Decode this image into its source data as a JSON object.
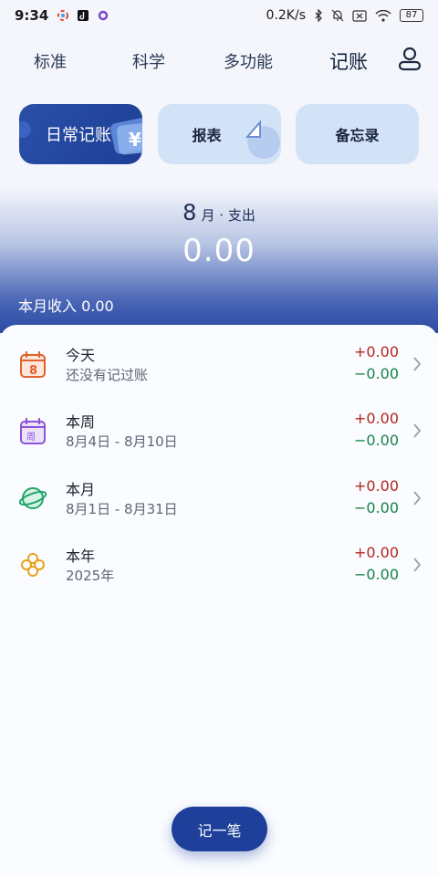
{
  "status_bar": {
    "time": "9:34",
    "net_speed": "0.2K/s",
    "battery": "87",
    "icons": [
      "colorful-app-icon",
      "tiktok-icon",
      "purple-dot-icon",
      "bluetooth-icon",
      "bell-off-icon",
      "sim-x-icon",
      "wifi-icon",
      "battery-icon"
    ]
  },
  "tabs": [
    "标准",
    "科学",
    "多功能",
    "记账"
  ],
  "active_tab": "记账",
  "cards": {
    "daily": "日常记账",
    "report": "报表",
    "memo": "备忘录"
  },
  "summary": {
    "month": "8",
    "month_suffix": "月 · 支出",
    "total_spend": "0.00",
    "income_label": "本月收入 0.00"
  },
  "periods": [
    {
      "title": "今天",
      "subtitle": "还没有记过账",
      "plus": "+0.00",
      "minus": "−0.00",
      "icon": "calendar-day-icon"
    },
    {
      "title": "本周",
      "subtitle": "8月4日 - 8月10日",
      "plus": "+0.00",
      "minus": "−0.00",
      "icon": "calendar-week-icon"
    },
    {
      "title": "本月",
      "subtitle": "8月1日 - 8月31日",
      "plus": "+0.00",
      "minus": "−0.00",
      "icon": "planet-icon"
    },
    {
      "title": "本年",
      "subtitle": "2025年",
      "plus": "+0.00",
      "minus": "−0.00",
      "icon": "clover-icon"
    }
  ],
  "add_button": "记一笔",
  "colors": {
    "accent": "#1e3f9a",
    "income_red": "#b3261e",
    "expense_green": "#15834a",
    "card_light": "#d3e3f7"
  }
}
